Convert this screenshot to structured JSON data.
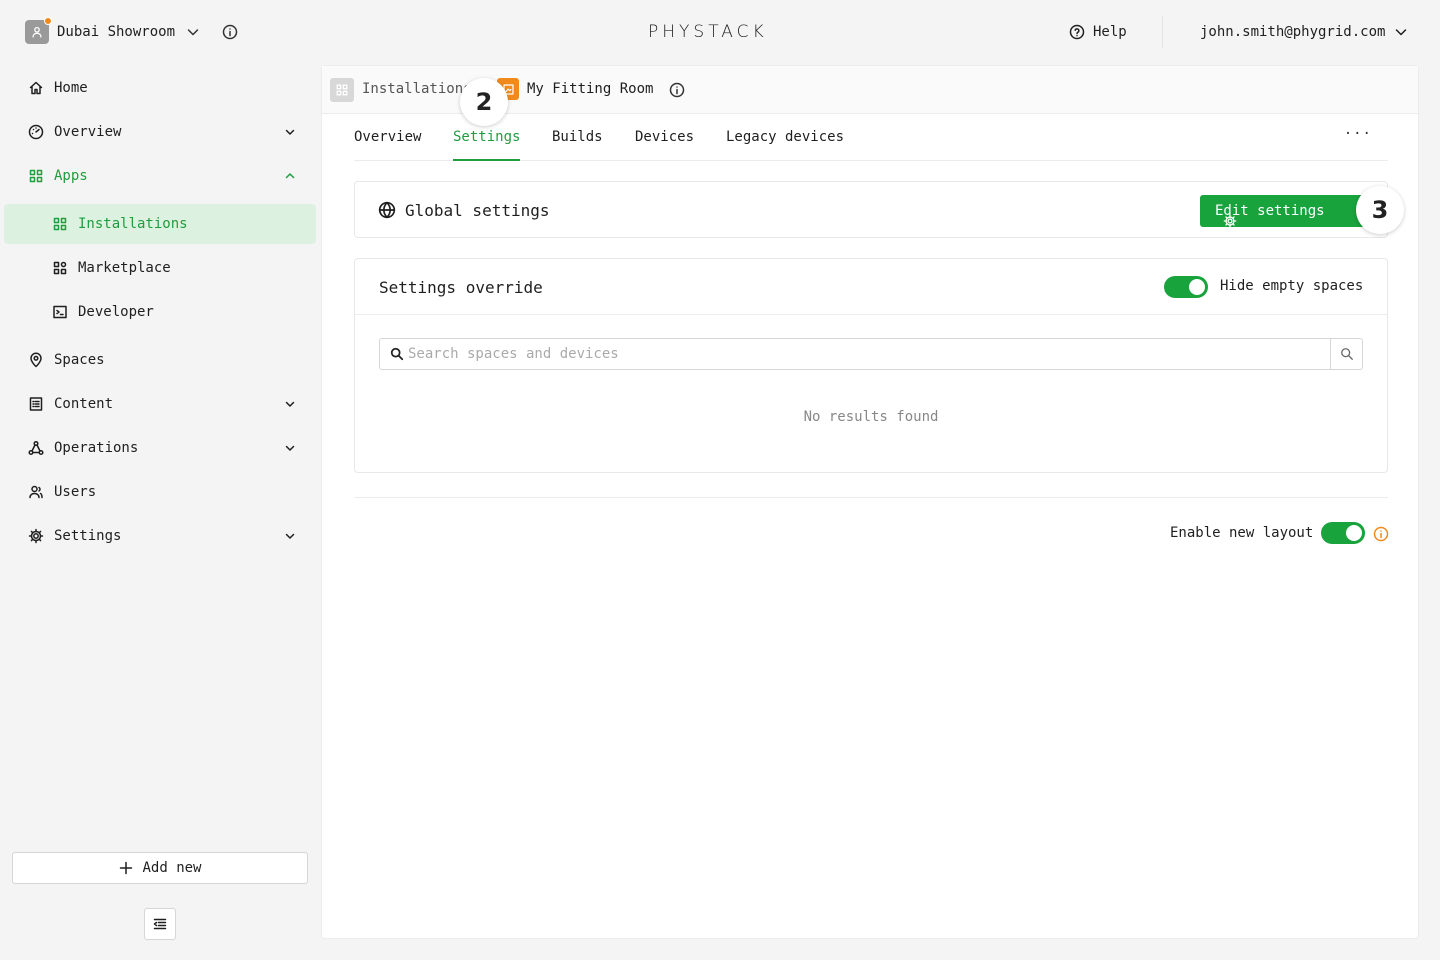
{
  "header": {
    "org_name": "Dubai Showroom",
    "logo_text": "PHYSTACK",
    "help_label": "Help",
    "user_email": "john.smith@phygrid.com",
    "org_status_color": "#f08a1c"
  },
  "sidebar": {
    "items": [
      {
        "label": "Home",
        "icon": "home-icon"
      },
      {
        "label": "Overview",
        "icon": "gauge-icon",
        "expandable": true
      },
      {
        "label": "Apps",
        "icon": "grid-icon",
        "expanded": true
      },
      {
        "label": "Installations",
        "icon": "grid-icon",
        "active": true
      },
      {
        "label": "Marketplace",
        "icon": "grid-plus-icon"
      },
      {
        "label": "Developer",
        "icon": "terminal-icon"
      },
      {
        "label": "Spaces",
        "icon": "pin-icon"
      },
      {
        "label": "Content",
        "icon": "document-icon",
        "expandable": true
      },
      {
        "label": "Operations",
        "icon": "network-icon",
        "expandable": true
      },
      {
        "label": "Users",
        "icon": "users-icon"
      },
      {
        "label": "Settings",
        "icon": "gear-icon",
        "expandable": true
      }
    ],
    "add_new_label": "Add new"
  },
  "breadcrumb": {
    "parent": "Installations",
    "current": "My Fitting Room"
  },
  "steps": [
    "2",
    "3"
  ],
  "tabs": [
    {
      "label": "Overview"
    },
    {
      "label": "Settings",
      "active": true
    },
    {
      "label": "Builds"
    },
    {
      "label": "Devices"
    },
    {
      "label": "Legacy devices"
    }
  ],
  "tabs_more": "···",
  "global_settings": {
    "title": "Global settings",
    "edit_label": "Edit settings"
  },
  "override": {
    "title": "Settings override",
    "toggle_label": "Hide empty spaces",
    "toggle_on": true,
    "search_placeholder": "Search spaces and devices",
    "search_value": "",
    "empty_text": "No results found"
  },
  "layout": {
    "label": "Enable new layout",
    "toggle_on": true
  },
  "colors": {
    "accent": "#1f9d3f",
    "button": "#19a33d",
    "active_bg": "#dcf1e0",
    "warning": "#f08a1c"
  }
}
